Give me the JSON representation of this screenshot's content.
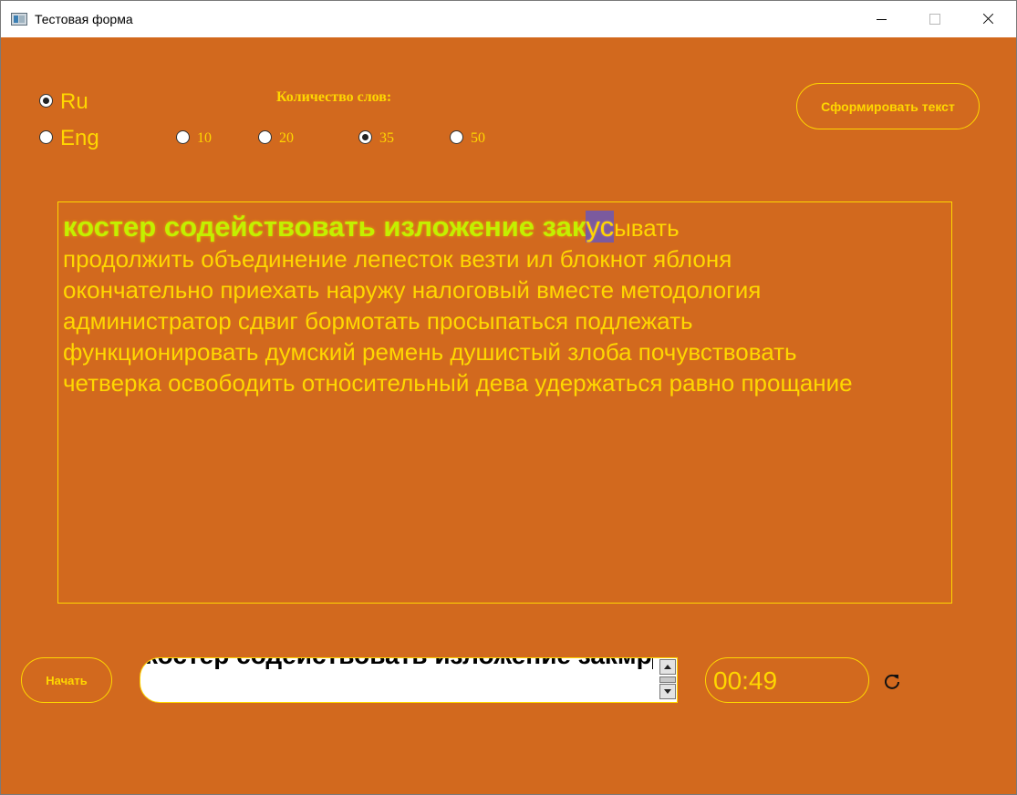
{
  "window": {
    "title": "Тестовая форма"
  },
  "language": {
    "options": [
      {
        "label": "Ru",
        "checked": true
      },
      {
        "label": "Eng",
        "checked": false
      }
    ]
  },
  "word_count": {
    "title": "Количество слов:",
    "options": [
      {
        "label": "10",
        "checked": false
      },
      {
        "label": "20",
        "checked": false
      },
      {
        "label": "35",
        "checked": true
      },
      {
        "label": "50",
        "checked": false
      }
    ]
  },
  "buttons": {
    "generate": "Сформировать текст",
    "start": "Начать"
  },
  "text": {
    "typed": "костер содействовать изложение зак",
    "error": "ус",
    "remaining_first_line": "ывать",
    "lines": [
      "продолжить объединение лепесток везти ил блокнот яблоня",
      "окончательно приехать наружу налоговый вместе методология",
      "администратор сдвиг бормотать просыпаться подлежать",
      "функционировать думский ремень душистый злоба почувствовать",
      "четверка освободить относительный дева удержаться равно прощание"
    ]
  },
  "input": {
    "value": "костер содействовать изложение закмр"
  },
  "timer": {
    "value": "00:49"
  },
  "colors": {
    "background": "#d2691e",
    "accent": "#ffd700",
    "typed": "#c3f000",
    "error_bg": "#7b5a9e"
  },
  "icons": {
    "refresh": "refresh-icon"
  }
}
